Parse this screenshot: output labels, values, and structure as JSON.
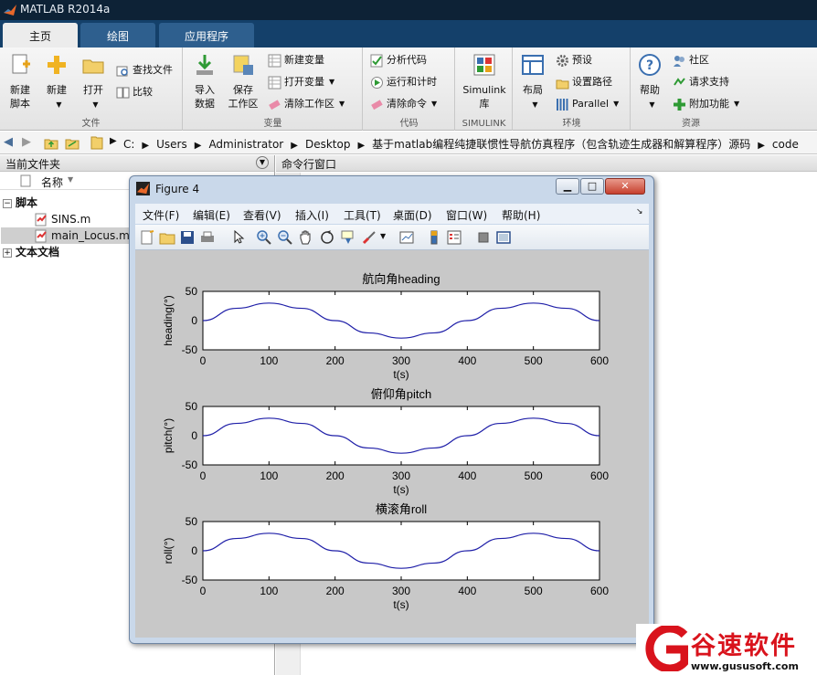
{
  "app": {
    "title": "MATLAB R2014a"
  },
  "tabs": [
    "主页",
    "绘图",
    "应用程序"
  ],
  "ribbon": {
    "file": {
      "new_script": "新建\n脚本",
      "new": "新建",
      "open": "打开",
      "find_files": "查找文件",
      "compare": "比较",
      "label": "文件"
    },
    "variable": {
      "import": "导入\n数据",
      "save_ws": "保存\n工作区",
      "new_var": "新建变量",
      "open_var": "打开变量",
      "clear_ws": "清除工作区",
      "label": "变量"
    },
    "code": {
      "analyze": "分析代码",
      "run_time": "运行和计时",
      "clear_cmd": "清除命令",
      "label": "代码"
    },
    "simulink": {
      "lib": "Simulink\n库",
      "label": "SIMULINK"
    },
    "env": {
      "layout": "布局",
      "prefs": "预设",
      "set_path": "设置路径",
      "parallel": "Parallel",
      "label": "环境"
    },
    "resources": {
      "help": "帮助",
      "community": "社区",
      "support": "请求支持",
      "addons": "附加功能",
      "label": "资源"
    }
  },
  "address": {
    "crumbs": [
      "C:",
      "Users",
      "Administrator",
      "Desktop",
      "基于matlab编程纯捷联惯性导航仿真程序（包含轨迹生成器和解算程序）源码",
      "code"
    ]
  },
  "left_panel": {
    "title": "当前文件夹",
    "col_name": "名称",
    "group_scripts": "脚本",
    "files": [
      "SINS.m",
      "main_Locus.m"
    ],
    "group_docs": "文本文档"
  },
  "right_panel": {
    "title": "命令行窗口"
  },
  "figure": {
    "title": "Figure 4",
    "menus": [
      "文件(F)",
      "编辑(E)",
      "查看(V)",
      "插入(I)",
      "工具(T)",
      "桌面(D)",
      "窗口(W)",
      "帮助(H)"
    ]
  },
  "chart_data": [
    {
      "type": "line",
      "title": "航向角heading",
      "xlabel": "t(s)",
      "ylabel": "heading(°)",
      "xlim": [
        0,
        600
      ],
      "ylim": [
        -50,
        50
      ],
      "xticks": [
        0,
        100,
        200,
        300,
        400,
        500,
        600
      ],
      "yticks": [
        50,
        0,
        -50
      ],
      "color": "#1f1fa8",
      "x": [
        0,
        50,
        100,
        150,
        200,
        250,
        300,
        350,
        400,
        450,
        500,
        550,
        600
      ],
      "y": [
        0,
        21,
        30,
        21,
        0,
        -21,
        -30,
        -21,
        0,
        21,
        30,
        21,
        0
      ]
    },
    {
      "type": "line",
      "title": "俯仰角pitch",
      "xlabel": "t(s)",
      "ylabel": "pitch(°)",
      "xlim": [
        0,
        600
      ],
      "ylim": [
        -50,
        50
      ],
      "xticks": [
        0,
        100,
        200,
        300,
        400,
        500,
        600
      ],
      "yticks": [
        50,
        0,
        -50
      ],
      "color": "#1f1fa8",
      "x": [
        0,
        50,
        100,
        150,
        200,
        250,
        300,
        350,
        400,
        450,
        500,
        550,
        600
      ],
      "y": [
        0,
        21,
        30,
        21,
        0,
        -21,
        -30,
        -21,
        0,
        21,
        30,
        21,
        0
      ]
    },
    {
      "type": "line",
      "title": "横滚角roll",
      "xlabel": "t(s)",
      "ylabel": "roll(°)",
      "xlim": [
        0,
        600
      ],
      "ylim": [
        -50,
        50
      ],
      "xticks": [
        0,
        100,
        200,
        300,
        400,
        500,
        600
      ],
      "yticks": [
        50,
        0,
        -50
      ],
      "color": "#1f1fa8",
      "x": [
        0,
        50,
        100,
        150,
        200,
        250,
        300,
        350,
        400,
        450,
        500,
        550,
        600
      ],
      "y": [
        0,
        21,
        30,
        21,
        0,
        -21,
        -30,
        -21,
        0,
        21,
        30,
        21,
        0
      ]
    }
  ],
  "watermark": {
    "brand": "谷速软件",
    "url": "www.gususoft.com",
    "color": "#d9131c"
  }
}
